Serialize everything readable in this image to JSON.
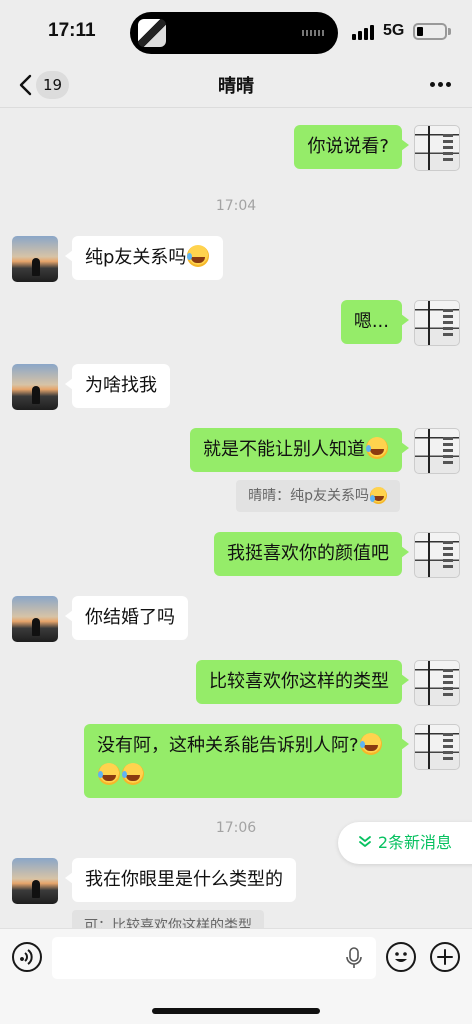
{
  "status_bar": {
    "time": "17:11",
    "network": "5G"
  },
  "nav": {
    "unread_count": "19",
    "title": "晴晴"
  },
  "messages": [
    {
      "from": "me",
      "text": "你说说看?"
    },
    {
      "type": "time",
      "text": "17:04"
    },
    {
      "from": "other",
      "text": "纯p友关系吗"
    },
    {
      "from": "me",
      "text": "嗯..."
    },
    {
      "from": "other",
      "text": "为啥找我"
    },
    {
      "from": "me",
      "text": "就是不能让别人知道"
    },
    {
      "type": "quote",
      "text": "晴晴：纯p友关系吗"
    },
    {
      "from": "me",
      "text": "我挺喜欢你的颜值吧"
    },
    {
      "from": "other",
      "text": "你结婚了吗"
    },
    {
      "from": "me",
      "text": "比较喜欢你这样的类型"
    },
    {
      "from": "me",
      "text": "没有阿，这种关系能告诉别人阿?"
    },
    {
      "type": "time",
      "text": "17:06"
    },
    {
      "from": "other",
      "text": "我在你眼里是什么类型的"
    },
    {
      "type": "quote",
      "text": "可：比较喜欢你这样的类型"
    }
  ],
  "new_messages_pill": "2条新消息",
  "icons": {
    "back": "chevron-left-icon",
    "more": "more-dots-icon",
    "voice": "voice-icon",
    "emoji": "emoji-icon",
    "add": "plus-icon",
    "mic": "microphone-icon"
  },
  "colors": {
    "my_bubble": "#95ec69",
    "other_bubble": "#ffffff",
    "accent": "#07c160",
    "background": "#ededed"
  }
}
